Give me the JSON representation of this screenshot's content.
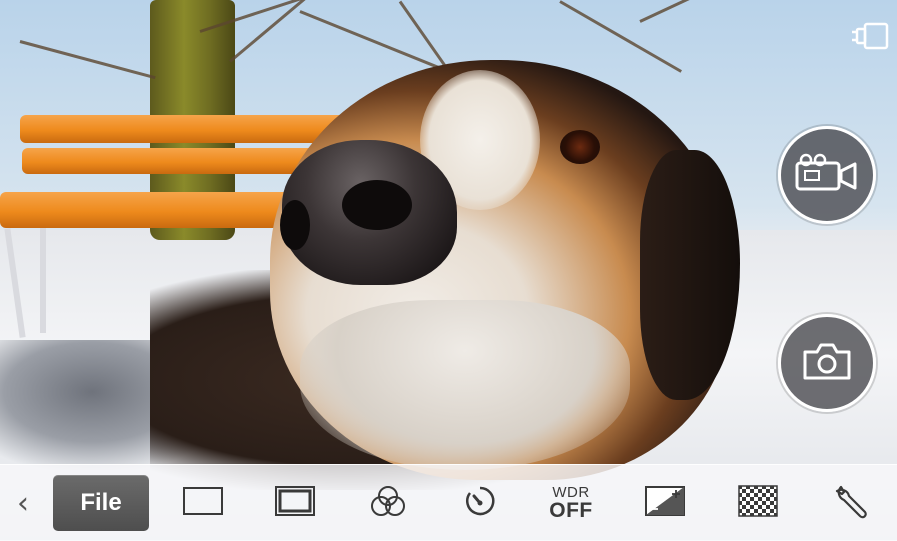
{
  "toolbar": {
    "back_icon": "chevron-left-icon",
    "file_label": "File",
    "items": [
      {
        "id": "aspect-ratio",
        "icon": "aspect-ratio-icon"
      },
      {
        "id": "frame",
        "icon": "frame-icon"
      },
      {
        "id": "color-effect",
        "icon": "color-circles-icon"
      },
      {
        "id": "timer",
        "icon": "timer-icon"
      },
      {
        "id": "exposure",
        "icon": "exposure-compensation-icon"
      },
      {
        "id": "pattern",
        "icon": "checkerboard-icon"
      },
      {
        "id": "settings",
        "icon": "wrench-icon"
      }
    ],
    "wdr": {
      "top": "WDR",
      "bottom": "OFF"
    }
  },
  "controls": {
    "power_icon": "power-adapter-icon",
    "video_icon": "video-camera-icon",
    "photo_icon": "camera-icon"
  },
  "colors": {
    "button_fill": "#46464b",
    "button_ring": "#ffffff",
    "toolbar_bg": "#f8f8fa",
    "file_button": "#5a5a5a",
    "icon_color": "#3a3a3a"
  }
}
